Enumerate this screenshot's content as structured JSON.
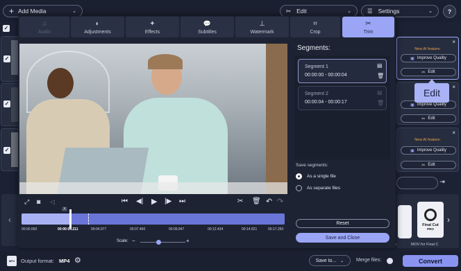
{
  "topbar": {
    "add_media_label": "Add Media",
    "edit_label": "Edit",
    "settings_label": "Settings",
    "help_label": "?"
  },
  "tabs": [
    {
      "label": "Audio",
      "icon": "music-note-icon"
    },
    {
      "label": "Adjustments",
      "icon": "adjust-icon"
    },
    {
      "label": "Effects",
      "icon": "magic-wand-icon"
    },
    {
      "label": "Subtitles",
      "icon": "subtitles-icon"
    },
    {
      "label": "Watermark",
      "icon": "stamp-icon"
    },
    {
      "label": "Crop",
      "icon": "crop-icon"
    },
    {
      "label": "Trim",
      "icon": "scissors-icon"
    }
  ],
  "segments": {
    "title": "Segments:",
    "items": [
      {
        "name": "Segment 1",
        "range": "00:00:00 - 00:00:04"
      },
      {
        "name": "Segment 2",
        "range": "00:00:04 - 00:00:17"
      }
    ]
  },
  "save_segments": {
    "title": "Save segments:",
    "options": [
      "As a single file",
      "As separate files"
    ],
    "selected": "As a single file"
  },
  "buttons": {
    "reset": "Reset",
    "save_close": "Save and Close"
  },
  "timeline": {
    "ticks": [
      "00:00.000",
      "00:03.211",
      "00:04.977",
      "00:07.460",
      "00:09.947",
      "00:12.434",
      "00:14.921",
      "00:17.250"
    ],
    "playhead_time": "00:00:03.211",
    "marker_label": "X",
    "scale_label": "Scale:",
    "scale_minus": "−",
    "scale_plus": "+",
    "scale_value": 0.4
  },
  "right_panel": {
    "ai_feature": "New AI feature:",
    "improve_quality": "Improve Quality",
    "edit_label": "Edit",
    "tooltip": "Edit",
    "format_caption": "MOV for Final C",
    "format_name": "Final Cut",
    "format_sub": "PRO",
    "partial_caption": "e"
  },
  "bottombar": {
    "output_label": "Output format:",
    "output_value": "MP4",
    "save_to": "Save to...",
    "merge_files": "Merge files:",
    "convert": "Convert"
  },
  "colors": {
    "accent": "#9aa5f5",
    "convert": "#8a94f0",
    "timeline_fill": "#6a75d8",
    "ai_orange": "#f0a040"
  }
}
